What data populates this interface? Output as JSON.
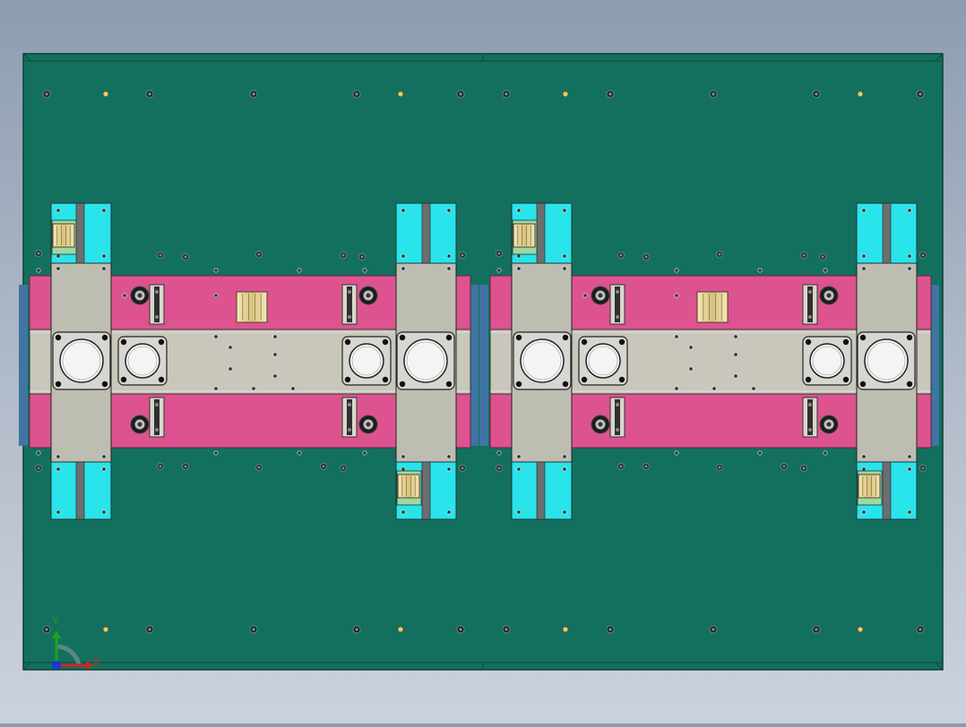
{
  "viewport": {
    "colors": {
      "background_top": "#8d9db1",
      "background_bottom": "#ccd2dc",
      "plate": "#13705e",
      "plate_edge": "#0d3f36",
      "rail": "#dd5390",
      "bar": "#c9c6bb",
      "block": "#29e4eb",
      "carriage": "#bebdb2",
      "side_strip": "#3f75a2",
      "clamp": "#e6d499"
    }
  },
  "axis": {
    "x_label": "X",
    "y_label": "Y",
    "x_color": "#d62020",
    "y_color": "#1aa51a",
    "origin_color": "#1638d6"
  }
}
